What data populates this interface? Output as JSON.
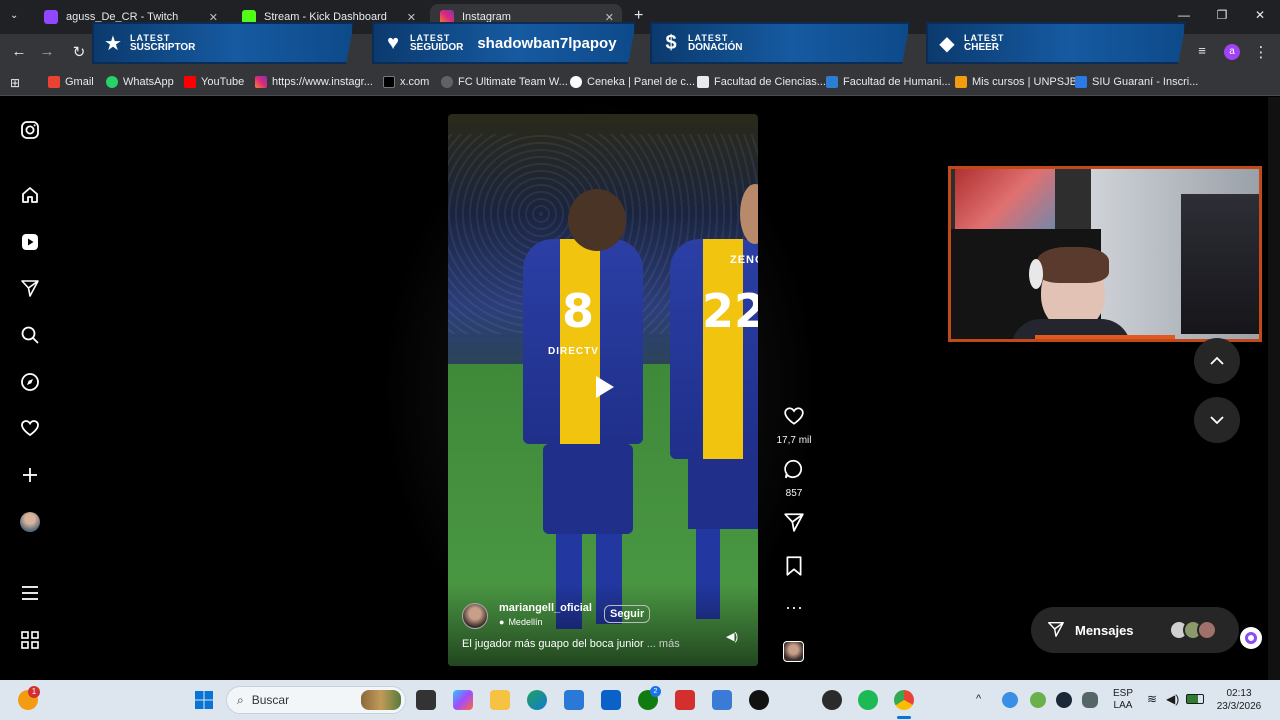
{
  "browser": {
    "tabs": [
      {
        "title": "aguss_De_CR - Twitch",
        "color": "#9146ff",
        "active": false
      },
      {
        "title": "Stream - Kick Dashboard",
        "color": "#53fc18",
        "active": false
      },
      {
        "title": "Instagram",
        "color": "#e1306c",
        "active": true
      }
    ],
    "new_tab": "+",
    "window_controls": {
      "minimize": "—",
      "restore": "❐",
      "close": "✕"
    },
    "profile_initial": "a",
    "bookmarks": [
      {
        "label": "Gmail",
        "color": "#ea4335"
      },
      {
        "label": "WhatsApp",
        "color": "#25d366"
      },
      {
        "label": "YouTube",
        "color": "#ff0000"
      },
      {
        "label": "https://www.instagr...",
        "color": "#e1306c"
      },
      {
        "label": "x.com",
        "color": "#000000"
      },
      {
        "label": "FC Ultimate Team W...",
        "color": "#5f6368"
      },
      {
        "label": "Ceneka | Panel de c...",
        "color": "#5f6368"
      },
      {
        "label": "Facultad de Ciencias...",
        "color": "#1a3e8c"
      },
      {
        "label": "Facultad de Humani...",
        "color": "#2d7dd2"
      },
      {
        "label": "Mis cursos | UNPSJB",
        "color": "#f39c12"
      },
      {
        "label": "SIU Guaraní - Inscri...",
        "color": "#2c7be5"
      }
    ]
  },
  "overlay": {
    "banners": [
      {
        "icon": "★",
        "kicker": "LATEST",
        "label": "SUSCRIPTOR",
        "value": ""
      },
      {
        "icon": "♥",
        "kicker": "LATEST",
        "label": "SEGUIDOR",
        "value": "shadowban7lpapoy"
      },
      {
        "icon": "$",
        "kicker": "LATEST",
        "label": "DONACIÓN",
        "value": ""
      },
      {
        "icon": "◆",
        "kicker": "LATEST",
        "label": "CHEER",
        "value": ""
      }
    ]
  },
  "instagram": {
    "sidebar_icons": [
      "instagram-logo-icon",
      "home-icon",
      "reels-icon",
      "send-icon",
      "search-icon",
      "explore-icon",
      "heart-icon",
      "create-icon",
      "profile-avatar",
      "menu-icon",
      "apps-icon"
    ],
    "reel": {
      "username": "mariangell_oficial",
      "location": "Medellín",
      "follow_label": "Seguir",
      "caption": "El jugador más guapo del boca junior",
      "more_label": "... más",
      "jersey_left_number": "8",
      "jersey_left_name": "DIRECTV",
      "jersey_right_number": "22",
      "jersey_right_name": "ZENON"
    },
    "actions": {
      "likes": "17,7 mil",
      "comments": "857"
    },
    "messages_label": "Mensajes"
  },
  "taskbar": {
    "search_placeholder": "Buscar",
    "notification_count": "1",
    "xbox_badge": "2",
    "language": "ESP",
    "layout": "LAA",
    "time": "02:13",
    "date": "23/3/2026"
  }
}
